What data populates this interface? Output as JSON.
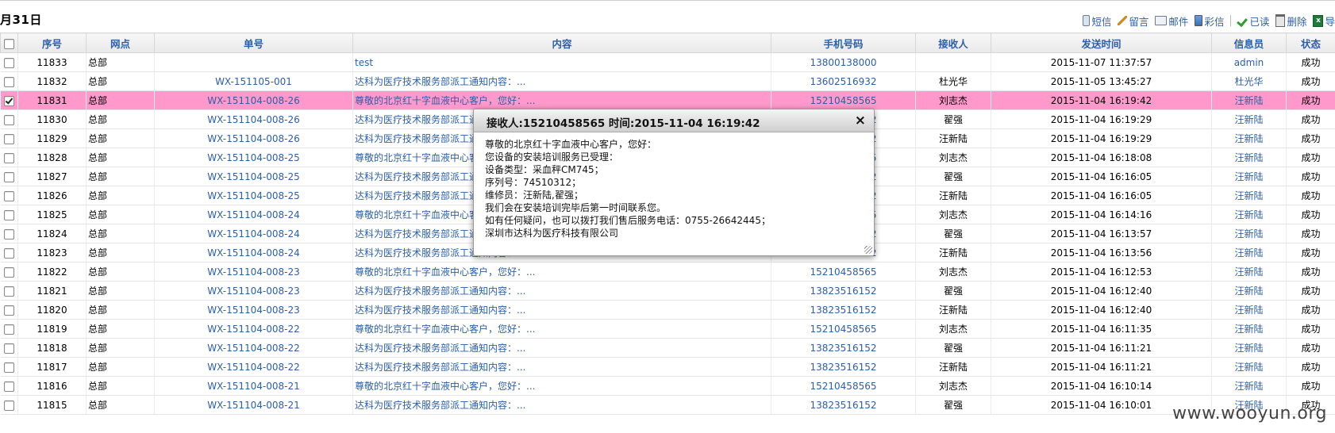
{
  "page": {
    "title": "月31日"
  },
  "toolbar": {
    "sms": "短信",
    "message": "留言",
    "email": "邮件",
    "mms": "彩信",
    "read": "已读",
    "delete": "删除",
    "export": "导"
  },
  "table": {
    "headers": [
      "序号",
      "网点",
      "单号",
      "内容",
      "手机号码",
      "接收人",
      "发送时间",
      "信息员",
      "状态"
    ],
    "rows": [
      {
        "id": "11833",
        "branch": "总部",
        "order": "",
        "content": "test",
        "phone": "13800138000",
        "receiver": "",
        "time": "2015-11-07 11:37:57",
        "operator": "admin",
        "status": "成功",
        "checked": false,
        "selected": false
      },
      {
        "id": "11832",
        "branch": "总部",
        "order": "WX-151105-001",
        "content": "达科为医疗技术服务部派工通知内容：...",
        "phone": "13602516932",
        "receiver": "杜光华",
        "time": "2015-11-05 13:45:27",
        "operator": "杜光华",
        "status": "成功",
        "checked": false,
        "selected": false
      },
      {
        "id": "11831",
        "branch": "总部",
        "order": "WX-151104-008-26",
        "content": "尊敬的北京红十字血液中心客户，您好：...",
        "phone": "15210458565",
        "receiver": "刘志杰",
        "time": "2015-11-04 16:19:42",
        "operator": "汪新陆",
        "status": "成功",
        "checked": true,
        "selected": true
      },
      {
        "id": "11830",
        "branch": "总部",
        "order": "WX-151104-008-26",
        "content": "达科为医疗技术服务部派工通知内容：...",
        "phone": "13823516152",
        "receiver": "翟强",
        "time": "2015-11-04 16:19:29",
        "operator": "汪新陆",
        "status": "成功",
        "checked": false,
        "selected": false
      },
      {
        "id": "11829",
        "branch": "总部",
        "order": "WX-151104-008-26",
        "content": "达科为医疗技术服务部派工通知内容：...",
        "phone": "13823516152",
        "receiver": "汪新陆",
        "time": "2015-11-04 16:19:29",
        "operator": "汪新陆",
        "status": "成功",
        "checked": false,
        "selected": false
      },
      {
        "id": "11828",
        "branch": "总部",
        "order": "WX-151104-008-25",
        "content": "尊敬的北京红十字血液中心客户，您好：...",
        "phone": "15210458565",
        "receiver": "刘志杰",
        "time": "2015-11-04 16:18:08",
        "operator": "汪新陆",
        "status": "成功",
        "checked": false,
        "selected": false
      },
      {
        "id": "11827",
        "branch": "总部",
        "order": "WX-151104-008-25",
        "content": "达科为医疗技术服务部派工通知内容：...",
        "phone": "13823516152",
        "receiver": "翟强",
        "time": "2015-11-04 16:16:05",
        "operator": "汪新陆",
        "status": "成功",
        "checked": false,
        "selected": false
      },
      {
        "id": "11826",
        "branch": "总部",
        "order": "WX-151104-008-25",
        "content": "达科为医疗技术服务部派工通知内容：...",
        "phone": "13823516152",
        "receiver": "汪新陆",
        "time": "2015-11-04 16:16:05",
        "operator": "汪新陆",
        "status": "成功",
        "checked": false,
        "selected": false
      },
      {
        "id": "11825",
        "branch": "总部",
        "order": "WX-151104-008-24",
        "content": "尊敬的北京红十字血液中心客户，您好：...",
        "phone": "15210458565",
        "receiver": "刘志杰",
        "time": "2015-11-04 16:14:16",
        "operator": "汪新陆",
        "status": "成功",
        "checked": false,
        "selected": false
      },
      {
        "id": "11824",
        "branch": "总部",
        "order": "WX-151104-008-24",
        "content": "达科为医疗技术服务部派工通知内容：...",
        "phone": "13823516152",
        "receiver": "翟强",
        "time": "2015-11-04 16:13:57",
        "operator": "汪新陆",
        "status": "成功",
        "checked": false,
        "selected": false
      },
      {
        "id": "11823",
        "branch": "总部",
        "order": "WX-151104-008-24",
        "content": "达科为医疗技术服务部派工通知内容：...",
        "phone": "13823516152",
        "receiver": "汪新陆",
        "time": "2015-11-04 16:13:56",
        "operator": "汪新陆",
        "status": "成功",
        "checked": false,
        "selected": false
      },
      {
        "id": "11822",
        "branch": "总部",
        "order": "WX-151104-008-23",
        "content": "尊敬的北京红十字血液中心客户，您好：...",
        "phone": "15210458565",
        "receiver": "刘志杰",
        "time": "2015-11-04 16:12:53",
        "operator": "汪新陆",
        "status": "成功",
        "checked": false,
        "selected": false
      },
      {
        "id": "11821",
        "branch": "总部",
        "order": "WX-151104-008-23",
        "content": "达科为医疗技术服务部派工通知内容：...",
        "phone": "13823516152",
        "receiver": "翟强",
        "time": "2015-11-04 16:12:40",
        "operator": "汪新陆",
        "status": "成功",
        "checked": false,
        "selected": false
      },
      {
        "id": "11820",
        "branch": "总部",
        "order": "WX-151104-008-23",
        "content": "达科为医疗技术服务部派工通知内容：...",
        "phone": "13823516152",
        "receiver": "汪新陆",
        "time": "2015-11-04 16:12:40",
        "operator": "汪新陆",
        "status": "成功",
        "checked": false,
        "selected": false
      },
      {
        "id": "11819",
        "branch": "总部",
        "order": "WX-151104-008-22",
        "content": "尊敬的北京红十字血液中心客户，您好：...",
        "phone": "15210458565",
        "receiver": "刘志杰",
        "time": "2015-11-04 16:11:35",
        "operator": "汪新陆",
        "status": "成功",
        "checked": false,
        "selected": false
      },
      {
        "id": "11818",
        "branch": "总部",
        "order": "WX-151104-008-22",
        "content": "达科为医疗技术服务部派工通知内容：...",
        "phone": "13823516152",
        "receiver": "翟强",
        "time": "2015-11-04 16:11:21",
        "operator": "汪新陆",
        "status": "成功",
        "checked": false,
        "selected": false
      },
      {
        "id": "11817",
        "branch": "总部",
        "order": "WX-151104-008-22",
        "content": "达科为医疗技术服务部派工通知内容：...",
        "phone": "13823516152",
        "receiver": "汪新陆",
        "time": "2015-11-04 16:11:21",
        "operator": "汪新陆",
        "status": "成功",
        "checked": false,
        "selected": false
      },
      {
        "id": "11816",
        "branch": "总部",
        "order": "WX-151104-008-21",
        "content": "尊敬的北京红十字血液中心客户，您好：...",
        "phone": "15210458565",
        "receiver": "刘志杰",
        "time": "2015-11-04 16:10:14",
        "operator": "汪新陆",
        "status": "成功",
        "checked": false,
        "selected": false
      },
      {
        "id": "11815",
        "branch": "总部",
        "order": "WX-151104-008-21",
        "content": "达科为医疗技术服务部派工通知内容：...",
        "phone": "13823516152",
        "receiver": "翟强",
        "time": "2015-11-04 16:10:01",
        "operator": "汪新陆",
        "status": "成功",
        "checked": false,
        "selected": false
      }
    ]
  },
  "popup": {
    "title": "接收人:15210458565 时间:2015-11-04 16:19:42",
    "close": "×",
    "lines": [
      "尊敬的北京红十字血液中心客户，您好：",
      "您设备的安装培训服务已受理：",
      "设备类型：采血秤CM745；",
      "序列号：74510312；",
      "维修员：汪新陆,翟强；",
      "我们会在安装培训完毕后第一时间联系您。",
      "如有任何疑问，也可以拨打我们售后服务电话：0755-26642445；",
      "深圳市达科为医疗科技有限公司"
    ]
  },
  "watermark": "www.wooyun.org"
}
